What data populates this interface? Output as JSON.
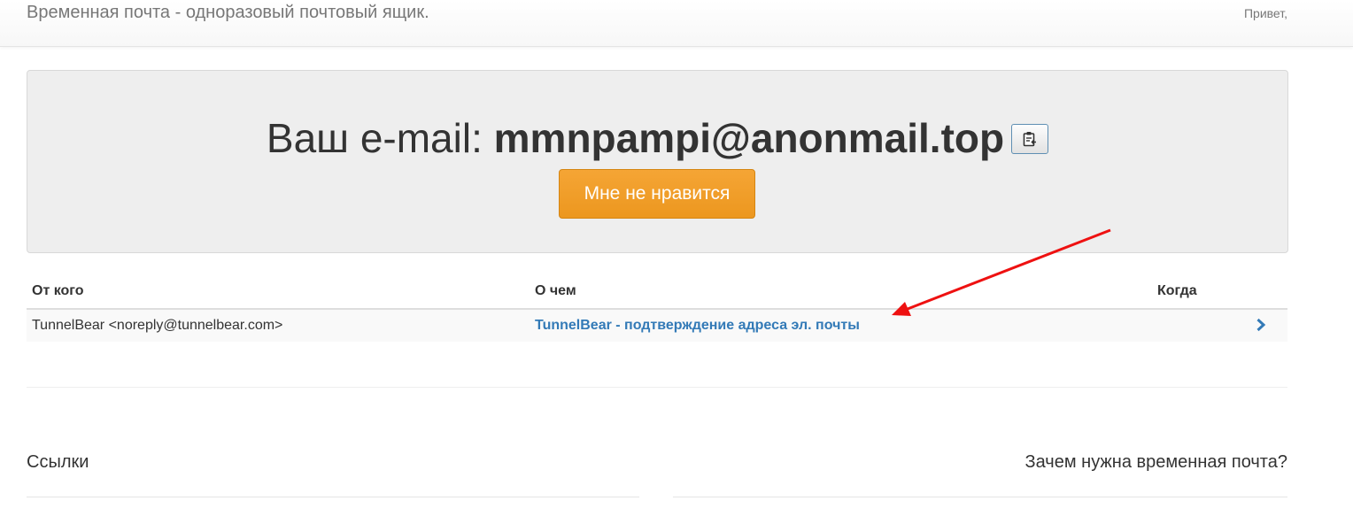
{
  "header": {
    "brand": "Временная почта - одноразовый почтовый ящик.",
    "greeting": "Привет,"
  },
  "mailbox": {
    "email_prefix": "Ваш e-mail: ",
    "email_address": "mmnpampi@anonmail.top",
    "copy_icon": "clipboard-icon",
    "dislike_label": "Мне не нравится",
    "dislike_color": "#f0ad4e"
  },
  "inbox": {
    "columns": [
      "От кого",
      "О чем",
      "Когда"
    ],
    "rows": [
      {
        "from": "TunnelBear <noreply@tunnelbear.com>",
        "subject": "TunnelBear - подтверждение адреса эл. почты",
        "when": ""
      }
    ],
    "link_color": "#337ab7"
  },
  "footer": {
    "links_title": "Ссылки",
    "why_title": "Зачем нужна временная почта?"
  },
  "annotation": {
    "arrow_color": "#ee1111"
  }
}
